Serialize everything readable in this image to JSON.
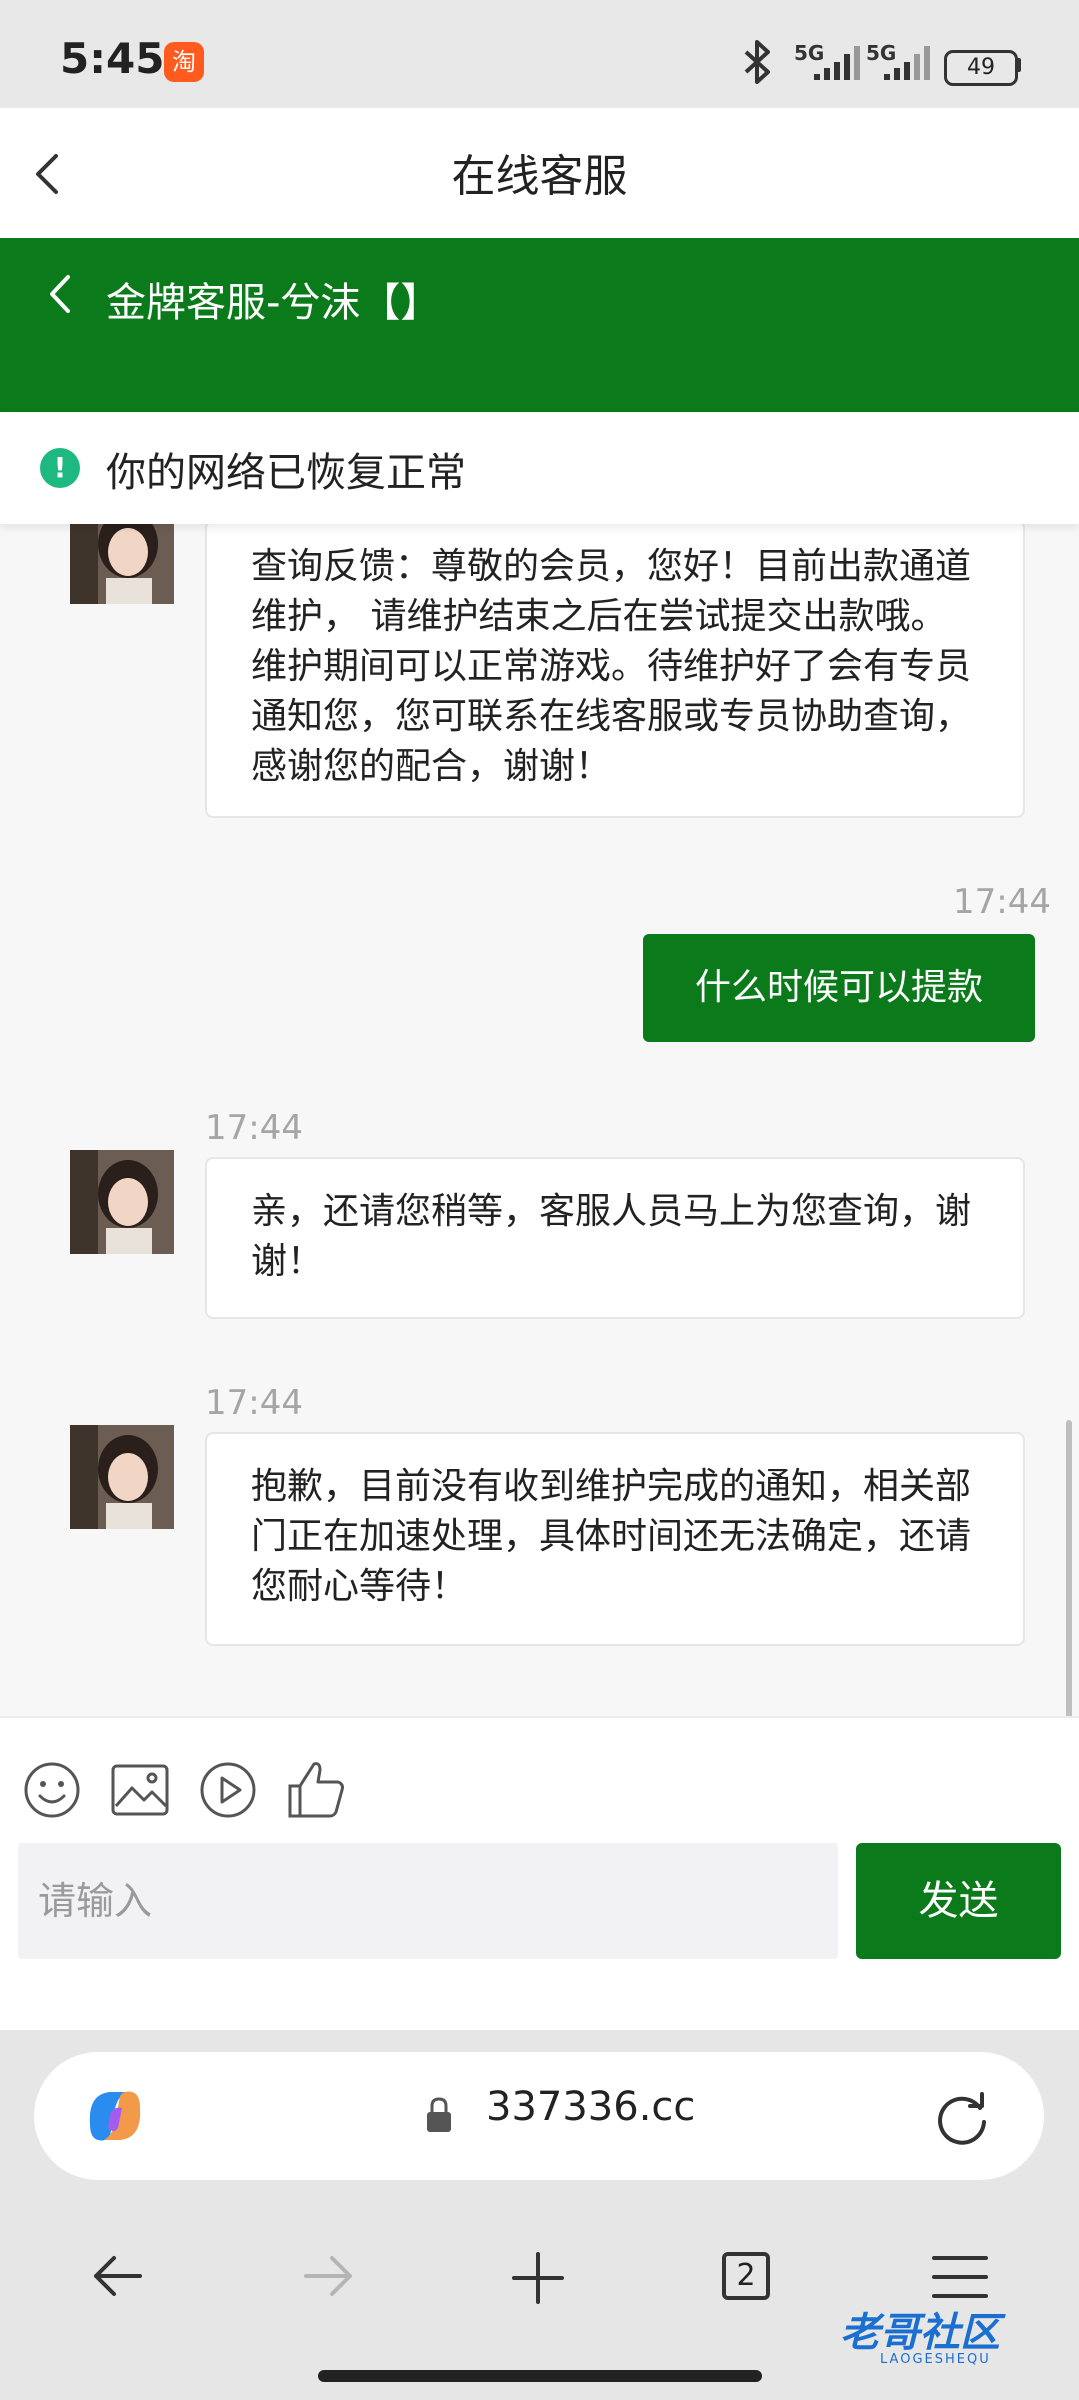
{
  "status_bar": {
    "time": "5:45",
    "taobao_badge": "淘",
    "network_1": "5G",
    "network_2": "5G",
    "battery": "49"
  },
  "title_bar": {
    "title": "在线客服"
  },
  "chat_header": {
    "agent_name": "金牌客服-兮沫【】"
  },
  "notice": {
    "text": "你的网络已恢复正常"
  },
  "messages": [
    {
      "from": "agent",
      "time": "",
      "text": "查询反馈：尊敬的会员，您好！目前出款通道维护， 请维护结束之后在尝试提交出款哦。维护期间可以正常游戏。待维护好了会有专员通知您，您可联系在线客服或专员协助查询， 感谢您的配合，谢谢！"
    },
    {
      "from": "user",
      "time": "17:44",
      "text": "什么时候可以提款"
    },
    {
      "from": "agent",
      "time": "17:44",
      "text": "亲，还请您稍等，客服人员马上为您查询，谢谢！"
    },
    {
      "from": "agent",
      "time": "17:44",
      "text": "抱歉，目前没有收到维护完成的通知，相关部门正在加速处理，具体时间还无法确定，还请您耐心等待！"
    }
  ],
  "composer": {
    "placeholder": "请输入",
    "send_label": "发送",
    "tools": [
      "emoji-icon",
      "image-icon",
      "video-icon",
      "thumbs-up-icon"
    ]
  },
  "browser": {
    "url": "337336.cc",
    "tab_count": "2"
  },
  "watermark": {
    "text": "老哥社区",
    "sub": "LAOGESHEQU"
  },
  "colors": {
    "brand_green": "#0a7a1b",
    "notice_green": "#1eb980"
  }
}
